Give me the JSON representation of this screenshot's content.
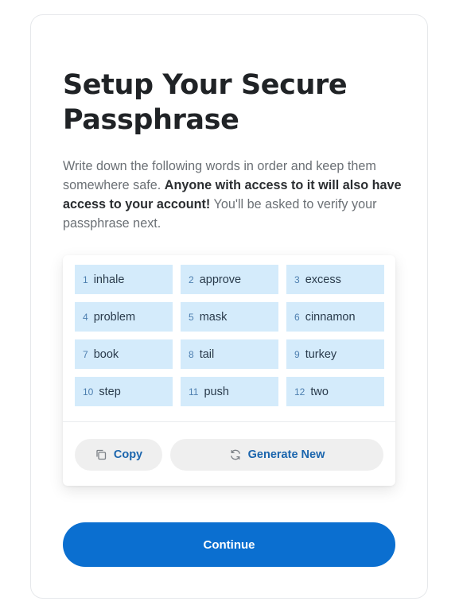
{
  "title": "Setup Your Secure Passphrase",
  "description": {
    "intro": "Write down the following words in order and keep them somewhere safe. ",
    "warning": "Anyone with access to it will also have access to your account!",
    "outro": " You'll be asked to verify your passphrase next."
  },
  "words": [
    {
      "num": "1",
      "word": "inhale"
    },
    {
      "num": "2",
      "word": "approve"
    },
    {
      "num": "3",
      "word": "excess"
    },
    {
      "num": "4",
      "word": "problem"
    },
    {
      "num": "5",
      "word": "mask"
    },
    {
      "num": "6",
      "word": "cinnamon"
    },
    {
      "num": "7",
      "word": "book"
    },
    {
      "num": "8",
      "word": "tail"
    },
    {
      "num": "9",
      "word": "turkey"
    },
    {
      "num": "10",
      "word": "step"
    },
    {
      "num": "11",
      "word": "push"
    },
    {
      "num": "12",
      "word": "two"
    }
  ],
  "actions": {
    "copy_label": "Copy",
    "copy_icon": "copy-icon",
    "generate_label": "Generate New",
    "generate_icon": "refresh-icon"
  },
  "continue_label": "Continue",
  "colors": {
    "accent": "#0b6fd0",
    "word_chip": "#d4ebfb",
    "secondary_button": "#efefef",
    "link_text": "#1b65ad"
  }
}
